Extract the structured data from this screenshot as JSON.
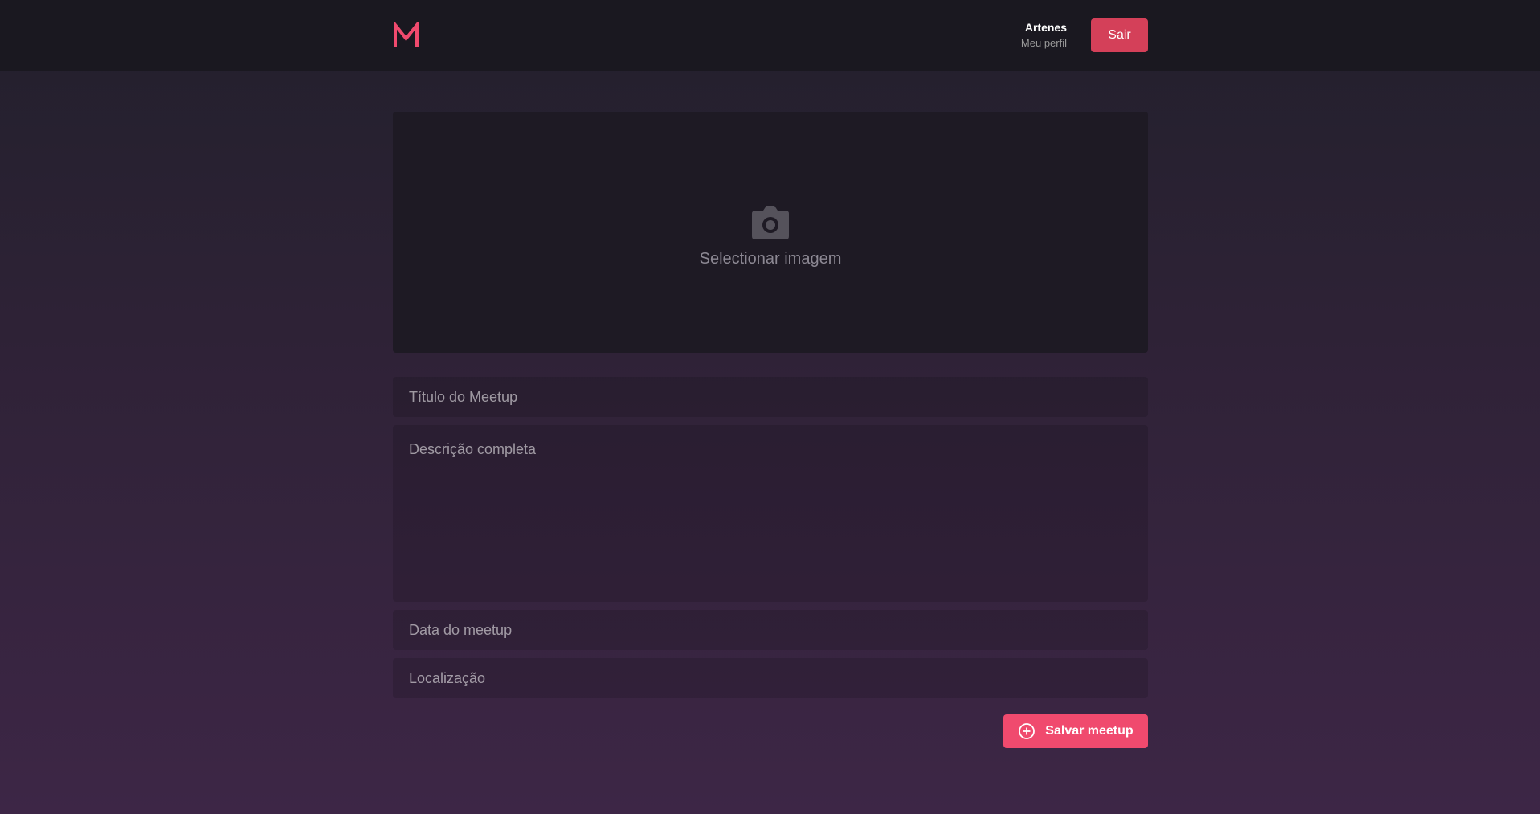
{
  "header": {
    "logo_letter": "M",
    "user_name": "Artenes",
    "profile_link": "Meu perfil",
    "logout_label": "Sair"
  },
  "form": {
    "image_picker": {
      "icon": "camera-icon",
      "label": "Selectionar imagem"
    },
    "title_placeholder": "Título do Meetup",
    "title_value": "",
    "description_placeholder": "Descrição completa",
    "description_value": "",
    "date_placeholder": "Data do meetup",
    "date_value": "",
    "location_placeholder": "Localização",
    "location_value": "",
    "save_icon": "plus-circle-icon",
    "save_label": "Salvar meetup"
  },
  "colors": {
    "accent": "#f04a6e",
    "logout": "#d44059",
    "header_bg": "#1a1820"
  }
}
